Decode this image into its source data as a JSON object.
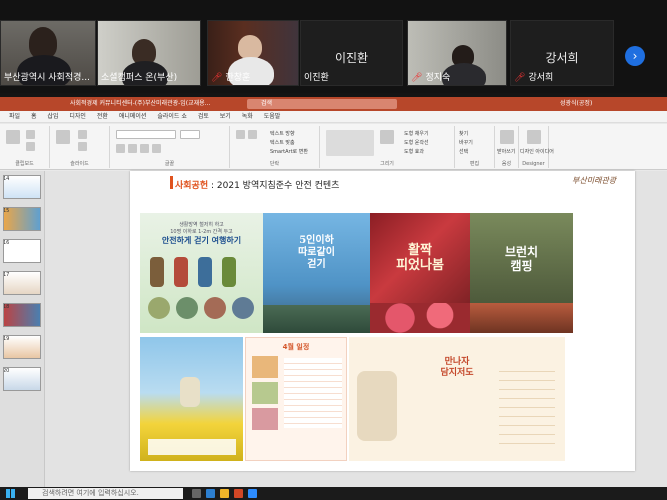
{
  "zoom": {
    "participants": [
      {
        "name": "부산광역시 사회적경...",
        "muted": false
      },
      {
        "name": "소셜캠퍼스 온(부산)",
        "muted": false
      },
      {
        "name": "한창훈",
        "muted": true
      },
      {
        "name": "이진환",
        "muted": false,
        "camera_off": true
      },
      {
        "name": "정지숙",
        "muted": true
      },
      {
        "name": "강서희",
        "muted": true,
        "camera_off": true
      }
    ],
    "next_icon": "chevron-right-icon"
  },
  "powerpoint": {
    "title_doc": "사회적경제 커뮤니티센터-(주)부산미래관광-임(교재용...",
    "search_placeholder": "검색",
    "user": "성광식(공정)",
    "menus": [
      "파일",
      "홈",
      "삽입",
      "디자인",
      "전환",
      "애니메이션",
      "슬라이드 쇼",
      "검토",
      "보기",
      "녹화",
      "도움말"
    ],
    "ribbon_groups": [
      "클립보드",
      "슬라이드",
      "글꼴",
      "단락",
      "그리기",
      "편집",
      "음성",
      "Designer"
    ],
    "ribbon_labels": {
      "text_direction": "텍스트 방향",
      "text_align": "텍스트 맞춤",
      "smartart": "SmartArt로 변환",
      "shape_fill": "도형 채우기",
      "shape_outline": "도형 윤곽선",
      "shape_effects": "도형 효과",
      "find": "찾기",
      "replace": "바꾸기",
      "select": "선택",
      "dictate": "받아쓰기",
      "designer": "디자인 아이디어"
    },
    "thumbnail_numbers": [
      "14",
      "15",
      "16",
      "17",
      "18",
      "19",
      "20"
    ]
  },
  "slide": {
    "title_accent": "사회공헌",
    "title_rest": ": 2021 방역지침준수 안전 컨텐츠",
    "logo": "부산미래관광",
    "posters": {
      "p1_top": "생활방역 철저히 하고\n10명 이하로 1-2m 간격 두고",
      "p1_main": "안전하게 걷기 여행하기",
      "p2_main": "5인이하\n따로같이\n걷기",
      "p3_main": "활짝\n피었나봄",
      "p4_main": "브런치\n캠핑",
      "b2_header": "4월 일정",
      "b3_main": "만나자\n담지저도"
    }
  },
  "taskbar": {
    "search_placeholder": "검색하려면 여기에 입력하십시오."
  }
}
